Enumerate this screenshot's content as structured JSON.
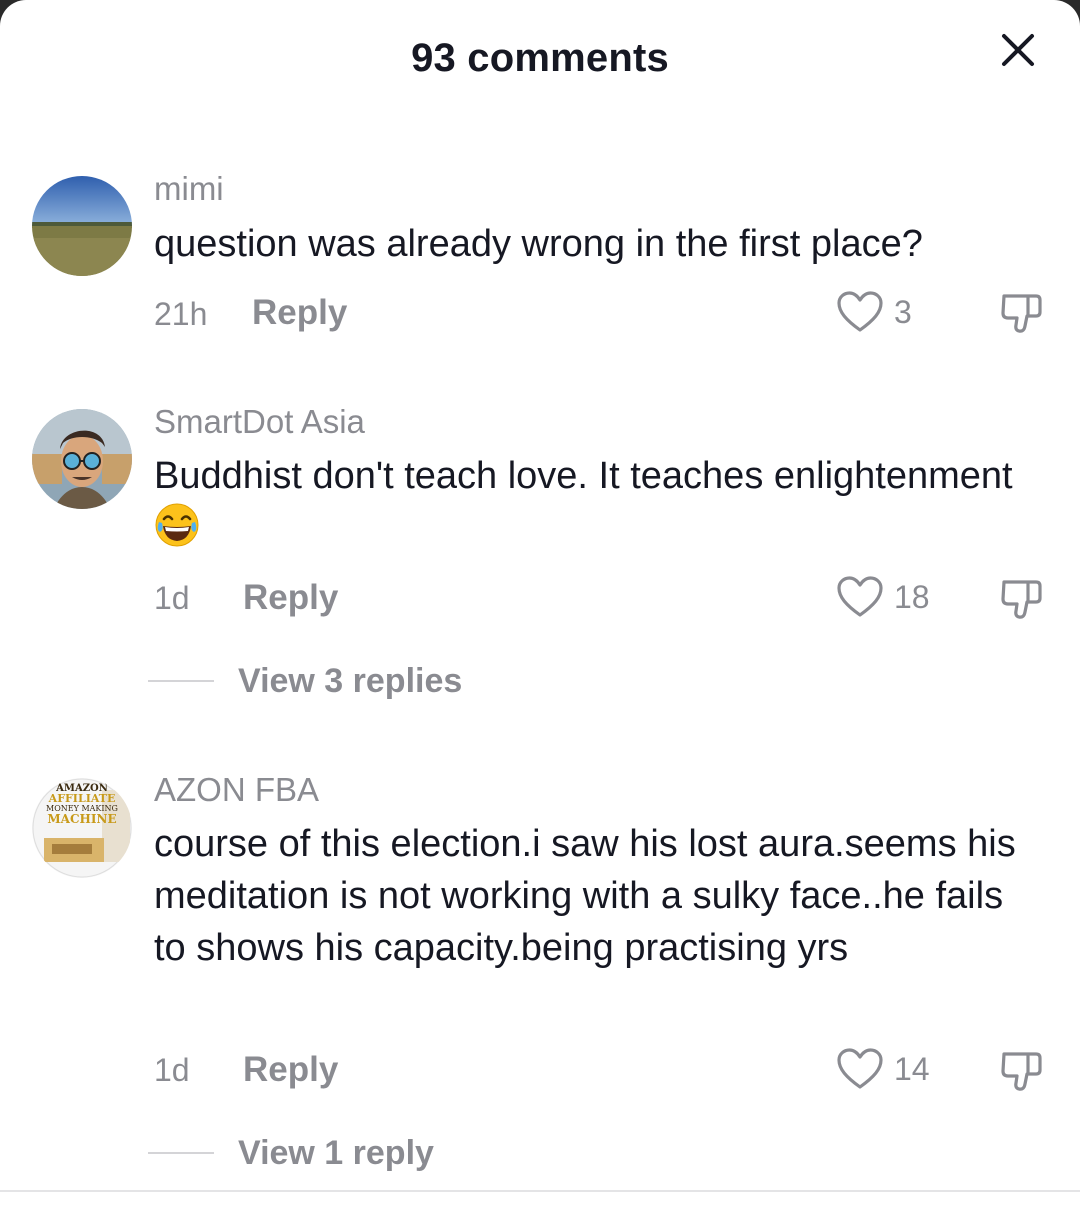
{
  "header": {
    "title": "93 comments",
    "close_icon": "close-icon"
  },
  "comments": [
    {
      "username": "mimi",
      "avatar_icon": "landscape-avatar",
      "text": "question was already wrong in the first place?",
      "time": "21h",
      "reply_label": "Reply",
      "likes": "3"
    },
    {
      "username": "SmartDot Asia",
      "avatar_icon": "man-sunglasses-avatar",
      "text": "Buddhist don't teach love. It teaches enlightenment",
      "emoji": "😂",
      "time": "1d",
      "reply_label": "Reply",
      "likes": "18",
      "view_replies": "View 3 replies"
    },
    {
      "username": "AZON FBA",
      "avatar_icon": "book-cover-avatar",
      "avatar_text": [
        "AMAZON",
        "AFFILIATE",
        "MONEY MAKING",
        "MACHINE"
      ],
      "text": "course of this election.i saw his lost aura.seems his meditation is not working with a sulky face..he fails to shows his capacity.being practising yrs",
      "time": "1d",
      "reply_label": "Reply",
      "likes": "14",
      "view_replies": "View 1 reply"
    }
  ],
  "colors": {
    "text_primary": "#161823",
    "text_secondary": "#8a8b91",
    "background": "#ffffff"
  }
}
